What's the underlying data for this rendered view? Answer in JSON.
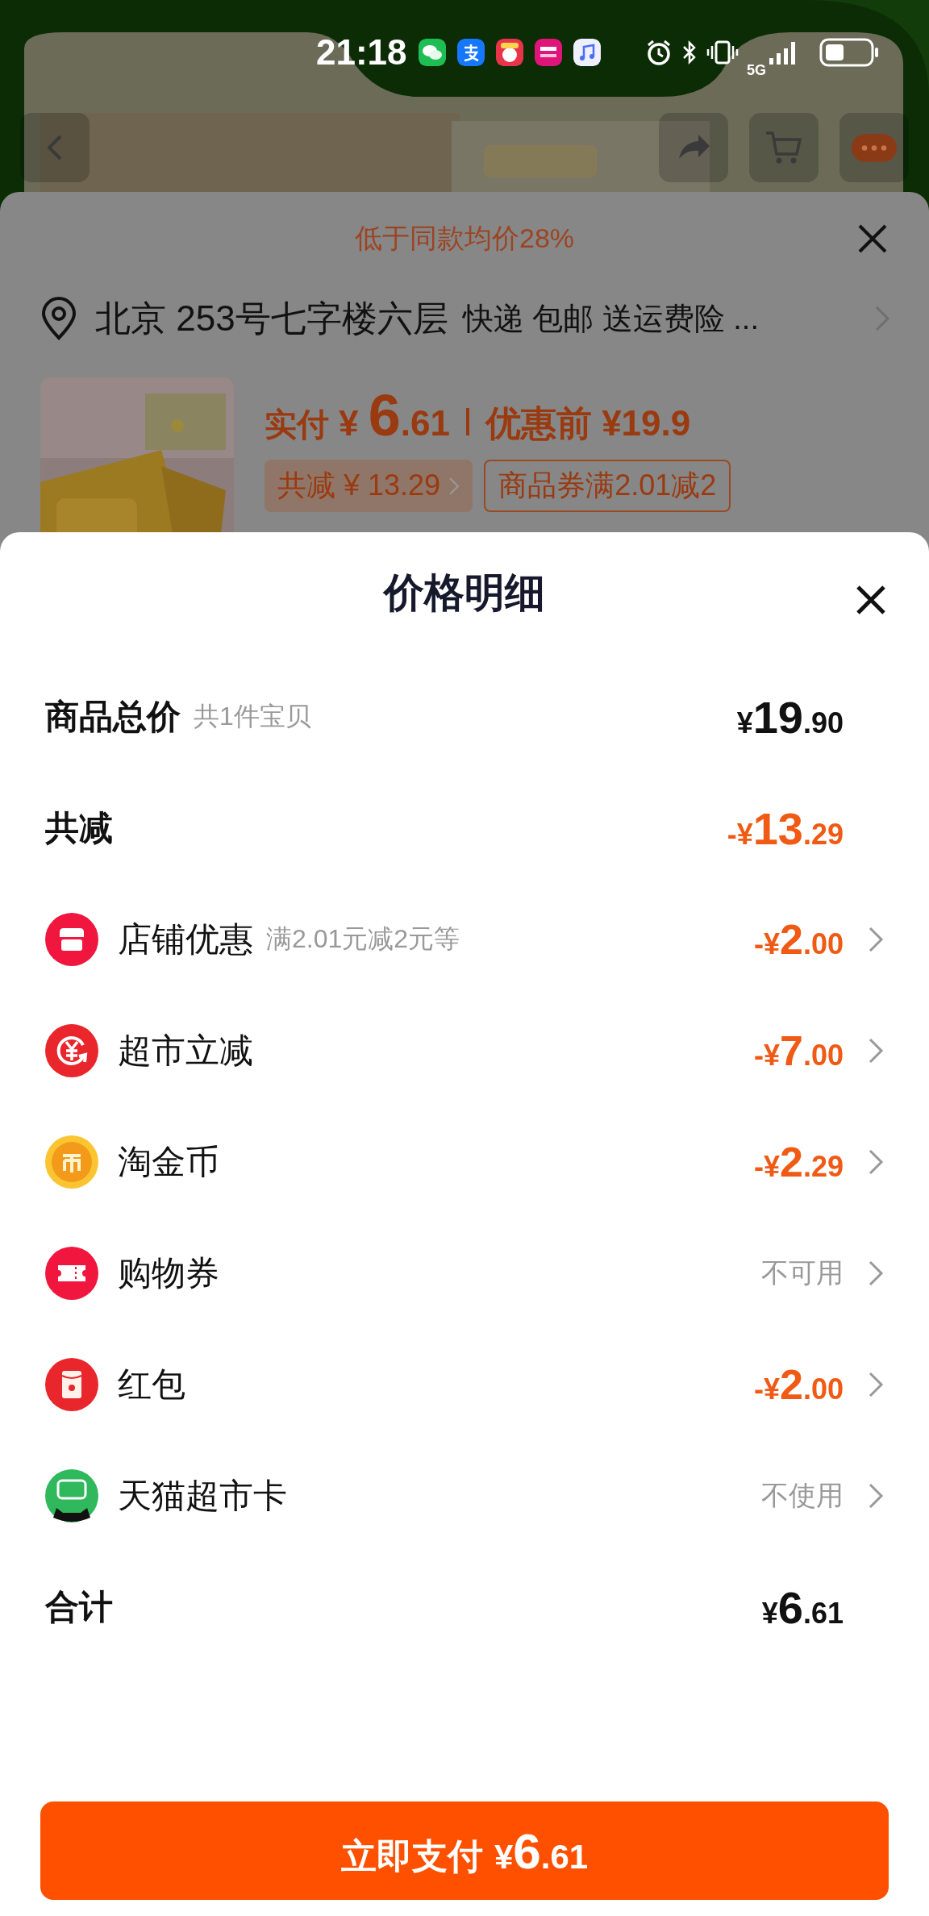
{
  "status_bar": {
    "time": "21:18",
    "network": "5G"
  },
  "order_sheet": {
    "savings_note": "低于同款均价28%",
    "address": "北京 253号七字楼六层",
    "delivery": "快递 包邮 送运费险 ...",
    "paid_label": "实付",
    "paid_amount": "¥ 6.61",
    "original_price": "优惠前 ¥19.9",
    "tags": [
      {
        "kind": "filled",
        "label": "共减 ¥ 13.29"
      },
      {
        "kind": "outline",
        "label": "商品券满2.01减2"
      }
    ]
  },
  "price_detail": {
    "title": "价格明细",
    "rows": [
      {
        "kind": "summary",
        "label": "商品总价",
        "note": "共1件宝贝",
        "value": "¥19.90",
        "color": "#111111",
        "chevron": false
      },
      {
        "kind": "summary",
        "label": "共减",
        "value": "-¥13.29",
        "color": "#f05a14",
        "chevron": false
      },
      {
        "kind": "item",
        "label": "店铺优惠",
        "note": "满2.01元减2元等",
        "value": "-¥2.00",
        "color": "#f05a14",
        "chevron": true
      },
      {
        "kind": "item",
        "label": "超市立减",
        "value": "-¥7.00",
        "color": "#f05a14",
        "chevron": true
      },
      {
        "kind": "item",
        "label": "淘金币",
        "value": "-¥2.29",
        "color": "#f05a14",
        "chevron": true
      },
      {
        "kind": "status",
        "label": "购物券",
        "value": "不可用",
        "color": "#999999",
        "chevron": true
      },
      {
        "kind": "item",
        "label": "红包",
        "value": "-¥2.00",
        "color": "#f05a14",
        "chevron": true
      },
      {
        "kind": "status",
        "label": "天猫超市卡",
        "value": "不使用",
        "color": "#999999",
        "chevron": true
      },
      {
        "kind": "summary",
        "label": "合计",
        "value": "¥6.61",
        "color": "#111111",
        "chevron": false
      }
    ],
    "pay_button": {
      "label": "立即支付",
      "amount": "¥6.61"
    }
  }
}
